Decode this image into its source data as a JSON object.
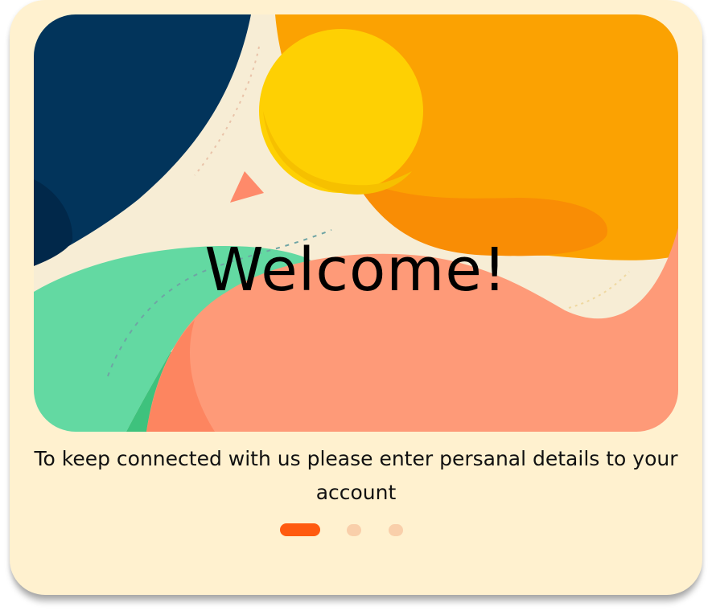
{
  "onboarding": {
    "title": "Welcome!",
    "subtitle": "To keep connected with us please enter persanal details to your account",
    "pager": {
      "total_pages": 3,
      "current_page": 1
    }
  },
  "colors": {
    "card_background": "#fff1cf",
    "accent": "#ff5a0f",
    "inactive_dot": "#f9cfaa",
    "navy": "#02345b",
    "orange": "#fba202",
    "yellow": "#fed003",
    "salmon": "#fe9a78",
    "mint": "#63d9a2"
  }
}
